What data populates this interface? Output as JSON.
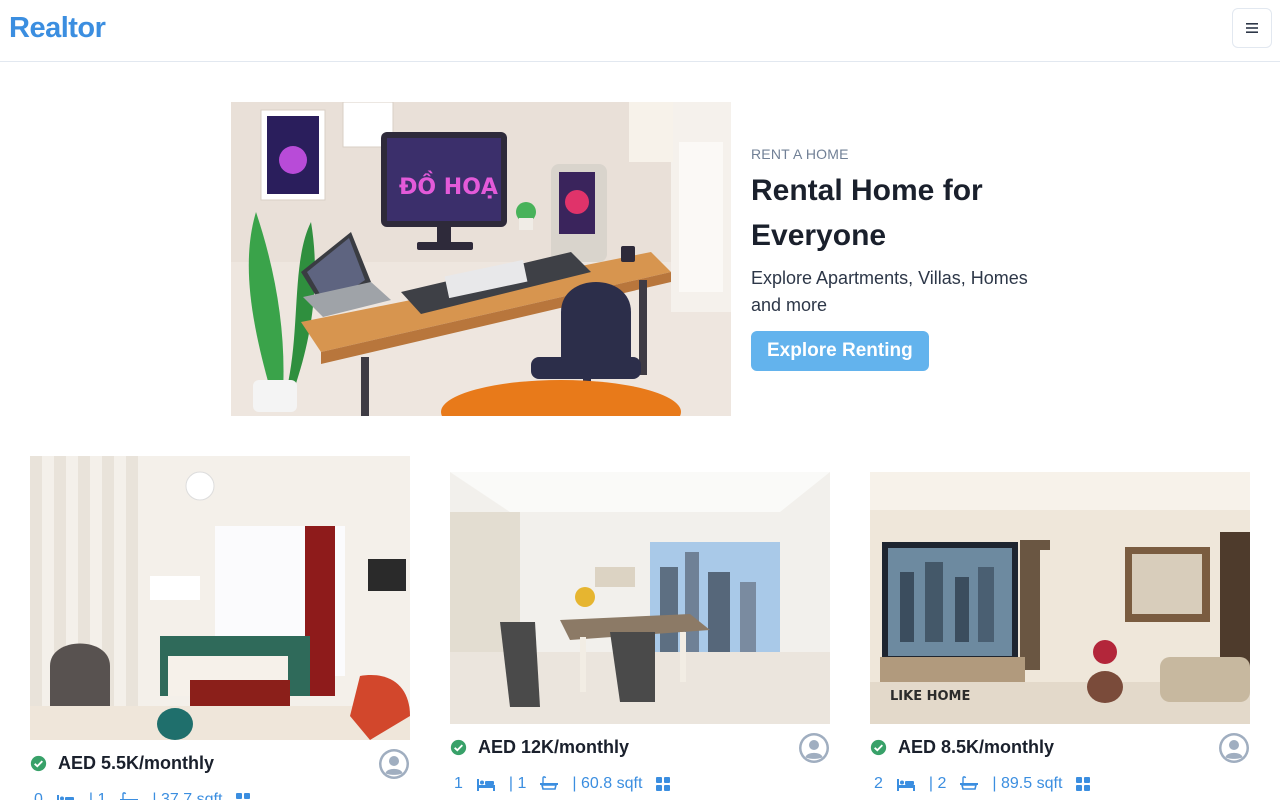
{
  "app": {
    "brand": "Realtor"
  },
  "nav": {
    "menu_icon": "hamburger-icon"
  },
  "hero": {
    "eyebrow": "RENT A HOME",
    "title": "Rental Home for Everyone",
    "description": "Explore Apartments, Villas, Homes and more",
    "cta_label": "Explore Renting"
  },
  "listings": [
    {
      "price": "AED 5.5K/monthly",
      "rooms": "0",
      "baths": "| 1",
      "area": "| 37.7 sqft"
    },
    {
      "price": "AED 12K/monthly",
      "rooms": "1",
      "baths": "| 1",
      "area": "| 60.8 sqft"
    },
    {
      "price": "AED 8.5K/monthly",
      "rooms": "2",
      "baths": "| 2",
      "area": "| 89.5 sqft"
    }
  ],
  "colors": {
    "brand": "#3b8ee0",
    "cta": "#63b3ed",
    "verified": "#38a169",
    "avatar": "#a0aec0"
  }
}
